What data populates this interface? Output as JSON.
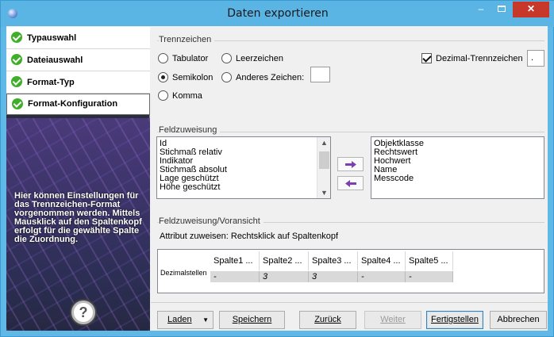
{
  "window": {
    "title": "Daten exportieren",
    "minimize": "–",
    "close": "✕"
  },
  "sidebar": {
    "steps": [
      {
        "label": "Typauswahl"
      },
      {
        "label": "Dateiauswahl"
      },
      {
        "label": "Format-Typ"
      },
      {
        "label": "Format-Konfiguration"
      }
    ],
    "hint": "Hier können Einstellungen für das Trennzeichen-Format vorgenommen werden. Mittels Mausklick auf den Spaltenkopf erfolgt für die gewählte Spalte die Zuordnung.",
    "help": "?"
  },
  "trennzeichen": {
    "group_label": "Trennzeichen",
    "tabulator": "Tabulator",
    "leerzeichen": "Leerzeichen",
    "semikolon": "Semikolon",
    "anderes": "Anderes Zeichen:",
    "komma": "Komma",
    "selected": "semikolon",
    "dezimal_label": "Dezimal-Trennzeichen",
    "dezimal_checked": true,
    "dezimal_value": "."
  },
  "feldzuweisung": {
    "group_label": "Feldzuweisung",
    "source_items": [
      "Id",
      "Stichmaß relativ",
      "Indikator",
      "Stichmaß absolut",
      "Lage geschützt",
      "Höhe geschützt"
    ],
    "target_items": [
      "Objektklasse",
      "Rechtswert",
      "Hochwert",
      "Name",
      "Messcode"
    ]
  },
  "vorschau": {
    "group_label": "Feldzuweisung/Voransicht",
    "hint": "Attribut zuweisen: Rechtsklick auf Spaltenkopf",
    "row_label": "Dezimalstellen",
    "columns": [
      "Spalte1 ...",
      "Spalte2 ...",
      "Spalte3 ...",
      "Spalte4 ...",
      "Spalte5 ..."
    ],
    "values": [
      "-",
      "3",
      "3",
      "-",
      "-"
    ]
  },
  "buttons": {
    "laden": "Laden",
    "speichern": "Speichern",
    "zurueck": "Zurück",
    "weiter": "Weiter",
    "fertigstellen": "Fertigstellen",
    "abbrechen": "Abbrechen"
  }
}
